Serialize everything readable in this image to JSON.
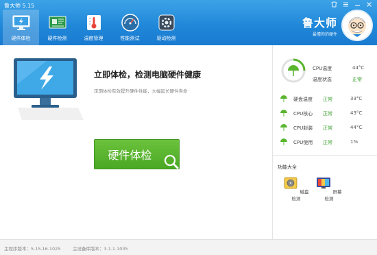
{
  "window": {
    "title": "鲁大师 5.15",
    "controls": [
      "skin-icon",
      "menu-icon",
      "minimize-icon",
      "close-icon"
    ]
  },
  "nav": {
    "items": [
      {
        "label": "硬件体检",
        "icon": "monitor-bolt-icon",
        "active": true
      },
      {
        "label": "硬件检测",
        "icon": "circuit-board-icon",
        "active": false
      },
      {
        "label": "温度管理",
        "icon": "thermometer-icon",
        "active": false
      },
      {
        "label": "性能测试",
        "icon": "speedometer-icon",
        "active": false
      },
      {
        "label": "驱动检测",
        "icon": "gear-box-icon",
        "active": false
      }
    ]
  },
  "brand": {
    "name": "鲁大师",
    "slogan": "最懂你的硬件"
  },
  "main": {
    "headline": "立即体检，检测电脑硬件健康",
    "subline": "定期体检有效提升硬件性能，大幅延长硬件寿命",
    "check_button": "硬件体检"
  },
  "side": {
    "summary": {
      "cpu_temp_label": "CPU温度",
      "cpu_temp_value": "44°C",
      "temp_status_label": "温度状态",
      "temp_status_value": "正常"
    },
    "rows": [
      {
        "label": "硬盘温度",
        "status": "正常",
        "value": "33°C"
      },
      {
        "label": "CPU核心",
        "status": "正常",
        "value": "43°C"
      },
      {
        "label": "CPU封装",
        "status": "正常",
        "value": "44°C"
      },
      {
        "label": "CPU使用",
        "status": "正常",
        "value": "1%"
      }
    ],
    "tools_title": "功能大全",
    "tools": [
      {
        "label": "磁盘检测",
        "icon": "disk-check-icon"
      },
      {
        "label": "屏幕检测",
        "icon": "screen-check-icon"
      }
    ]
  },
  "statusbar": {
    "main_version": "主程序版本：5.15.16.1025",
    "db_version": "主设备库版本：3.1.1.1035"
  },
  "colors": {
    "header_blue": "#1f86d8",
    "button_green": "#5bb52f",
    "ok_green": "#3da030"
  }
}
